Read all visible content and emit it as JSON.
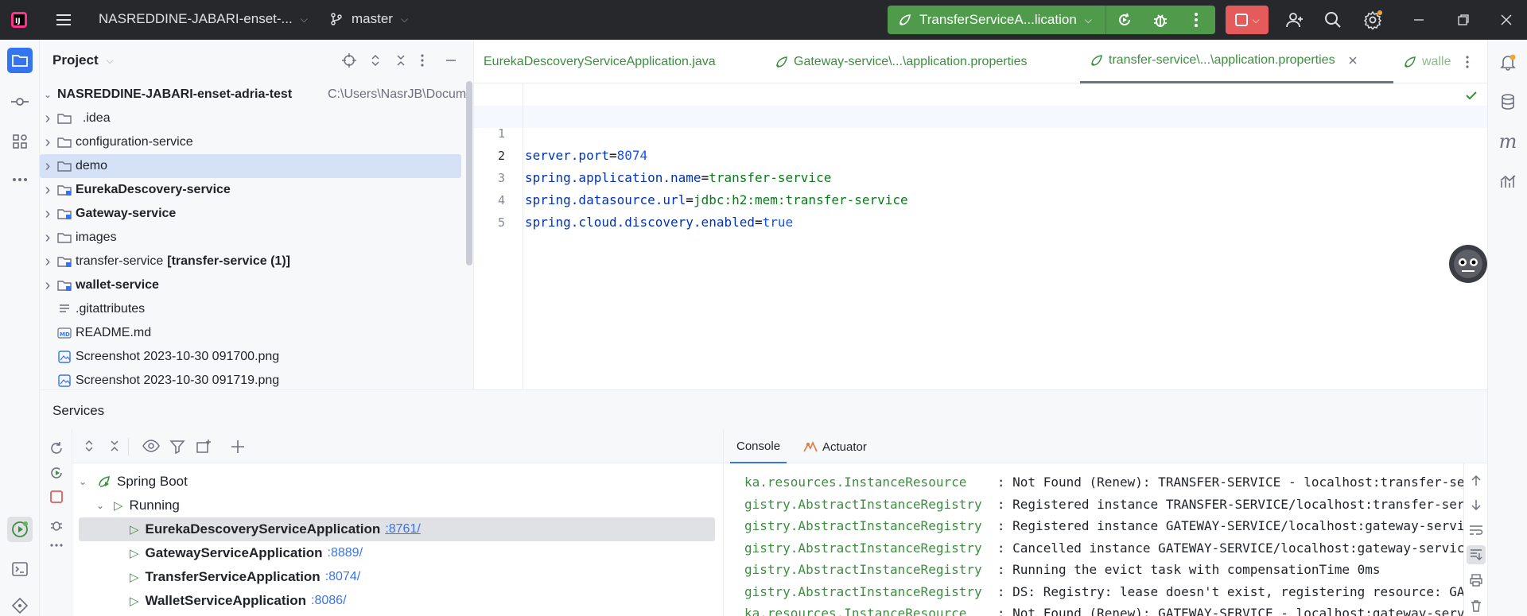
{
  "titlebar": {
    "project_name": "NASREDDINE-JABARI-enset-...",
    "branch": "master",
    "run_config": "TransferServiceA...lication"
  },
  "project_panel": {
    "title": "Project",
    "root": {
      "name": "NASREDDINE-JABARI-enset-adria-test",
      "path": "C:\\Users\\NasrJB\\Docum"
    },
    "items": [
      {
        "label": "  .idea",
        "expand": true
      },
      {
        "label": "configuration-service",
        "expand": true
      },
      {
        "label": "demo",
        "expand": true,
        "selected": true
      },
      {
        "label": "EurekaDescovery-service",
        "expand": true,
        "bold": true
      },
      {
        "label": "Gateway-service",
        "expand": true,
        "bold": true
      },
      {
        "label": "images",
        "expand": true
      },
      {
        "label": "transfer-service",
        "suffix": "[transfer-service (1)]",
        "expand": true
      },
      {
        "label": "wallet-service",
        "expand": true,
        "bold": true
      },
      {
        "label": ".gitattributes",
        "expand": false
      },
      {
        "label": "README.md",
        "expand": false
      },
      {
        "label": "Screenshot 2023-10-30 091700.png",
        "expand": false
      },
      {
        "label": "Screenshot 2023-10-30 091719.png",
        "expand": false
      }
    ]
  },
  "editor": {
    "tabs": [
      {
        "label": "EurekaDescoveryServiceApplication.java",
        "active": false
      },
      {
        "label": "Gateway-service\\...\\application.properties",
        "active": false
      },
      {
        "label": "transfer-service\\...\\application.properties",
        "active": true
      },
      {
        "label": "walle",
        "active": false
      }
    ],
    "line_numbers": [
      "1",
      "2",
      "3",
      "4",
      "5"
    ],
    "lines": [
      {
        "key": "",
        "value": ""
      },
      {
        "key": "server.port",
        "value": "8074"
      },
      {
        "key": "spring.application.name",
        "value": "transfer-service"
      },
      {
        "key": "spring.datasource.url",
        "value": "jdbc:h2:mem:transfer-service"
      },
      {
        "key": "spring.cloud.discovery.enabled",
        "value": "true"
      }
    ]
  },
  "services": {
    "title": "Services",
    "tree": {
      "root": "Spring Boot",
      "group": "Running",
      "apps": [
        {
          "name": "EurekaDescoveryServiceApplication",
          "port": ":8761/"
        },
        {
          "name": "GatewayServiceApplication",
          "port": ":8889/"
        },
        {
          "name": "TransferServiceApplication",
          "port": ":8074/"
        },
        {
          "name": "WalletServiceApplication",
          "port": ":8086/"
        }
      ]
    },
    "console_tabs": {
      "console": "Console",
      "actuator": "Actuator"
    },
    "log_lines": [
      {
        "src": "ka.resources.InstanceResource    ",
        "msg": ": Not Found (Renew): TRANSFER-SERVICE - localhost:transfer-ser"
      },
      {
        "src": "gistry.AbstractInstanceRegistry  ",
        "msg": ": Registered instance TRANSFER-SERVICE/localhost:transfer-serv"
      },
      {
        "src": "gistry.AbstractInstanceRegistry  ",
        "msg": ": Registered instance GATEWAY-SERVICE/localhost:gateway-servic"
      },
      {
        "src": "gistry.AbstractInstanceRegistry  ",
        "msg": ": Cancelled instance GATEWAY-SERVICE/localhost:gateway-service"
      },
      {
        "src": "gistry.AbstractInstanceRegistry  ",
        "msg": ": Running the evict task with compensationTime 0ms"
      },
      {
        "src": "gistry.AbstractInstanceRegistry  ",
        "msg": ": DS: Registry: lease doesn't exist, registering resource: GAT"
      },
      {
        "src": "ka.resources.InstanceResource    ",
        "msg": ": Not Found (Renew): GATEWAY-SERVICE - localhost:gateway-servi"
      }
    ]
  },
  "colors": {
    "titlebar_bg": "#27282c",
    "run_config_bg": "#4f9b4b",
    "stop_bg": "#e55b5b",
    "accent": "#3574f0",
    "spring_green": "#3b8f3e"
  }
}
